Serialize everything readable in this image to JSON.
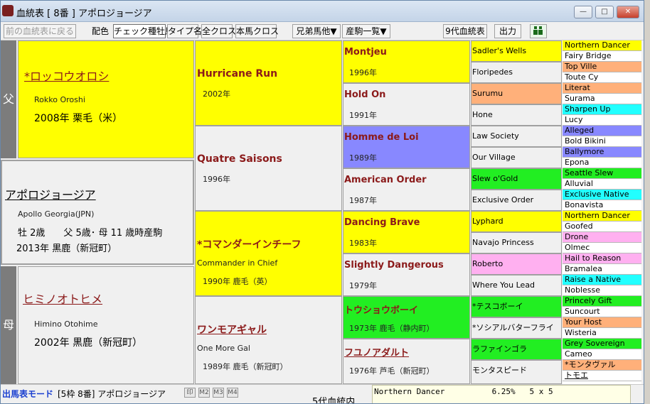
{
  "window": {
    "title": "血統表 [ 8番 ] アポロジョージア",
    "min": "—",
    "max": "□",
    "close": "✕"
  },
  "toolbar": {
    "prev": "前の血統表に戻る",
    "color": "配色",
    "check_sire": "チェック種牡馬",
    "type": "タイプ名",
    "all_cross": "全クロス",
    "self_cross": "本馬クロス",
    "siblings": "兄弟馬他▼",
    "foals": "産駒一覧▼",
    "gen9": "9代血統表",
    "output": "出力"
  },
  "labels": {
    "father": "父",
    "mother": "母"
  },
  "sire": {
    "name": "*ロッコウオロシ",
    "roman": "Rokko Oroshi",
    "info": "2008年  栗毛（米）"
  },
  "horse": {
    "name": "アポロジョージア",
    "roman": "Apollo Georgia(JPN)",
    "line1": "牡  2歳　　父 5歳･ 母 11 歳時産駒",
    "line2": "2013年  黒鹿（新冠町）"
  },
  "dam": {
    "name": "ヒミノオトヒメ",
    "roman": "Himino Otohime",
    "info": "2002年  黒鹿（新冠町）"
  },
  "gen2": [
    {
      "name": "Hurricane Run",
      "year": "2002年"
    },
    {
      "name": "Quatre Saisons",
      "year": "1996年"
    },
    {
      "name": "*コマンダーインチーフ",
      "roman": "Commander in Chief",
      "year": "1990年  鹿毛（英）"
    },
    {
      "name": "ワンモアギャル",
      "roman": "One More Gal",
      "year": "1989年  鹿毛（新冠町）"
    }
  ],
  "gen3": [
    {
      "name": "Montjeu",
      "year": "1996年"
    },
    {
      "name": "Hold On",
      "year": "1991年"
    },
    {
      "name": "Homme de Loi",
      "year": "1989年"
    },
    {
      "name": "American Order",
      "year": "1987年"
    },
    {
      "name": "Dancing Brave",
      "year": "1983年"
    },
    {
      "name": "Slightly Dangerous",
      "year": "1979年"
    },
    {
      "name": "トウショウボーイ",
      "year": "1973年  鹿毛（静内町）"
    },
    {
      "name": "フユノアダルト",
      "year": "1976年  芦毛（新冠町）"
    }
  ],
  "gen4": [
    "Sadler's Wells",
    "Floripedes",
    "Surumu",
    "Hone",
    "Law Society",
    "Our Village",
    "Slew o'Gold",
    "Exclusive Order",
    "Lyphard",
    "Navajo Princess",
    "Roberto",
    "Where You Lead",
    "*テスコボーイ",
    "*ソシアルバターフライ",
    "ラファインゴラ",
    "モンタスピード"
  ],
  "gen5": [
    "Northern Dancer",
    "Fairy Bridge",
    "Top Ville",
    "Toute Cy",
    "Literat",
    "Surama",
    "Sharpen Up",
    "Lucy",
    "Alleged",
    "Bold Bikini",
    "Ballymore",
    "Epona",
    "Seattle Slew",
    "Alluvial",
    "Exclusive Native",
    "Bonavista",
    "Northern Dancer",
    "Goofed",
    "Drone",
    "Olmec",
    "Hail to Reason",
    "Bramalea",
    "Raise a Native",
    "Noblesse",
    "Princely Gift",
    "Suncourt",
    "Your Host",
    "Wisteria",
    "Grey Sovereign",
    "Cameo",
    "*モンタヴァル",
    "トモエ"
  ],
  "status": {
    "mode": "出馬表モード",
    "entry": "[5枠 8番] アポロジョージア",
    "m1": "印",
    "m2": "M2",
    "m3": "M3",
    "m4": "M4",
    "five_gen": "5代血統内",
    "cross_text": "Northern Dancer          6.25%   5 x 5"
  },
  "colors": {
    "yellow": "#ffff00",
    "gray": "#f0f0f0",
    "orange": "#ffb07a",
    "cyan": "#22ffff",
    "periwinkle": "#8888ff",
    "green": "#22ee22",
    "pink": "#ffb0f0",
    "white": "#ffffff"
  }
}
